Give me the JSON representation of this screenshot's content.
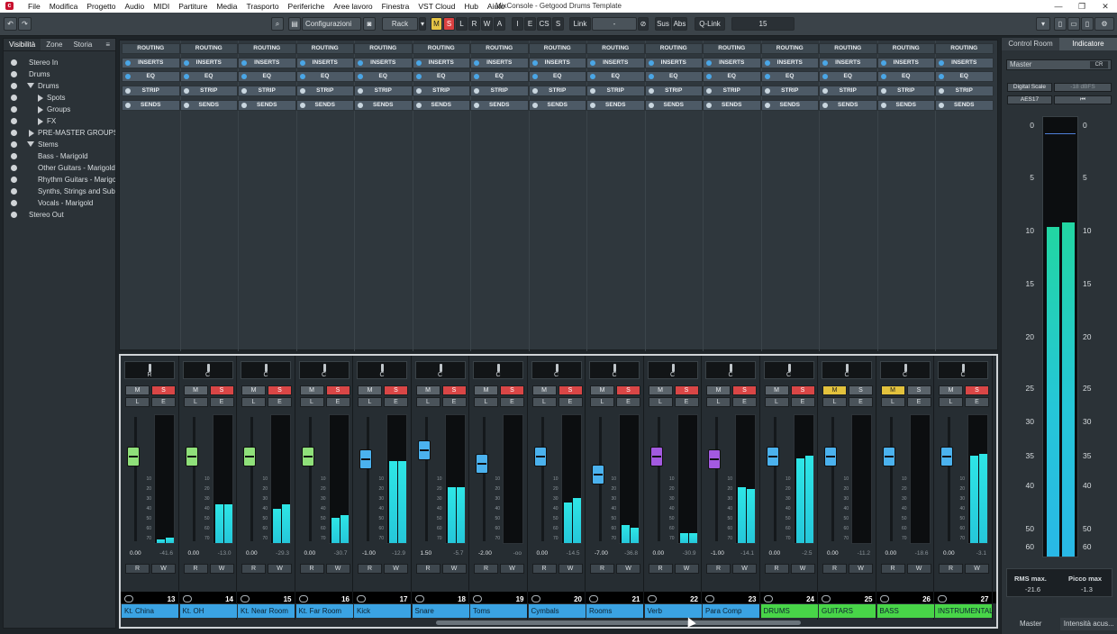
{
  "window": {
    "title": "MixConsole - Getgood Drums Template",
    "controls": [
      "—",
      "❐",
      "✕"
    ]
  },
  "menu": [
    "File",
    "Modifica",
    "Progetto",
    "Audio",
    "MIDI",
    "Partiture",
    "Media",
    "Trasporto",
    "Periferiche",
    "Aree lavoro",
    "Finestra",
    "VST Cloud",
    "Hub",
    "Aiuto"
  ],
  "toolbar": {
    "undo": "↶",
    "redo": "↷",
    "config": "Configurazioni",
    "rack": "Rack",
    "mslrwa": [
      "M",
      "S",
      "L",
      "R",
      "W",
      "A"
    ],
    "ies": [
      "I",
      "E",
      "CS",
      "S"
    ],
    "link": "Link",
    "link_value": "-",
    "sus": "Sus",
    "abs": "Abs",
    "qlink": "Q-Link",
    "count": "15"
  },
  "left_panel": {
    "tabs": [
      "Visibilità",
      "Zone",
      "Storia"
    ],
    "tree": [
      {
        "label": "Stereo In",
        "kind": "dot"
      },
      {
        "label": "Drums",
        "kind": "dot"
      },
      {
        "label": "Drums",
        "kind": "folder-open"
      },
      {
        "label": "Spots",
        "kind": "folder-closed"
      },
      {
        "label": "Groups",
        "kind": "folder-closed"
      },
      {
        "label": "FX",
        "kind": "folder-closed"
      },
      {
        "label": "PRE-MASTER GROUPS",
        "kind": "folder-closed"
      },
      {
        "label": "Stems",
        "kind": "folder-open"
      },
      {
        "label": "Bass - Marigold",
        "kind": "dot"
      },
      {
        "label": "Other Guitars - Marigold",
        "kind": "dot"
      },
      {
        "label": "Rhythm Guitars - Marigold",
        "kind": "dot"
      },
      {
        "label": "Synths, Strings and Sub...",
        "kind": "dot"
      },
      {
        "label": "Vocals - Marigold",
        "kind": "dot"
      },
      {
        "label": "Stereo Out",
        "kind": "dot"
      }
    ]
  },
  "rack_rows": [
    "ROUTING",
    "INSERTS",
    "EQ",
    "STRIP",
    "SENDS"
  ],
  "channels": [
    {
      "name": "Kt. China",
      "num": "13",
      "pan": "R",
      "vol": "0.00",
      "peak": "-41.6",
      "fader": 0.69,
      "meter": [
        0.03,
        0.04
      ],
      "cap": "green",
      "name_color": "#3aa3e3",
      "m_on": false,
      "s_on": true
    },
    {
      "name": "Kt. OH",
      "num": "14",
      "pan": "C",
      "vol": "0.00",
      "peak": "-13.0",
      "fader": 0.69,
      "meter": [
        0.3,
        0.3
      ],
      "cap": "green",
      "name_color": "#3aa3e3",
      "m_on": false,
      "s_on": true
    },
    {
      "name": "Kt. Near Room",
      "num": "15",
      "pan": "C",
      "vol": "0.00",
      "peak": "-29.3",
      "fader": 0.69,
      "meter": [
        0.27,
        0.3
      ],
      "cap": "green",
      "name_color": "#3aa3e3",
      "m_on": false,
      "s_on": true
    },
    {
      "name": "Kt. Far Room",
      "num": "16",
      "pan": "C",
      "vol": "0.00",
      "peak": "-30.7",
      "fader": 0.69,
      "meter": [
        0.2,
        0.22
      ],
      "cap": "green",
      "name_color": "#3aa3e3",
      "m_on": false,
      "s_on": true
    },
    {
      "name": "Kick",
      "num": "17",
      "pan": "C",
      "vol": "-1.00",
      "peak": "-12.9",
      "fader": 0.66,
      "meter": [
        0.64,
        0.64
      ],
      "cap": "blue",
      "name_color": "#3aa3e3",
      "m_on": false,
      "s_on": true
    },
    {
      "name": "Snare",
      "num": "18",
      "pan": "C",
      "vol": "1.50",
      "peak": "-5.7",
      "fader": 0.75,
      "meter": [
        0.44,
        0.44
      ],
      "cap": "blue",
      "name_color": "#3aa3e3",
      "m_on": false,
      "s_on": true
    },
    {
      "name": "Toms",
      "num": "19",
      "pan": "C",
      "vol": "-2.00",
      "peak": "-oo",
      "fader": 0.62,
      "meter": [
        0,
        0
      ],
      "cap": "blue",
      "name_color": "#3aa3e3",
      "m_on": false,
      "s_on": true
    },
    {
      "name": "Cymbals",
      "num": "20",
      "pan": "C",
      "vol": "0.00",
      "peak": "-14.5",
      "fader": 0.69,
      "meter": [
        0.32,
        0.35
      ],
      "cap": "blue",
      "name_color": "#3aa3e3",
      "m_on": false,
      "s_on": true
    },
    {
      "name": "Rooms",
      "num": "21",
      "pan": "C",
      "vol": "-7.00",
      "peak": "-36.8",
      "fader": 0.52,
      "meter": [
        0.14,
        0.12
      ],
      "cap": "blue",
      "name_color": "#3aa3e3",
      "m_on": false,
      "s_on": true
    },
    {
      "name": "Verb",
      "num": "22",
      "pan": "C",
      "vol": "0.00",
      "peak": "-30.9",
      "fader": 0.69,
      "meter": [
        0.08,
        0.08
      ],
      "cap": "purple",
      "name_color": "#3aa3e3",
      "m_on": false,
      "s_on": true
    },
    {
      "name": "Para Comp",
      "num": "23",
      "pan": "C",
      "vol": "-1.00",
      "peak": "-14.1",
      "fader": 0.66,
      "meter": [
        0.44,
        0.42
      ],
      "cap": "purple",
      "name_color": "#3aa3e3",
      "m_on": false,
      "s_on": true
    },
    {
      "name": "DRUMS",
      "num": "24",
      "pan": "C",
      "vol": "0.00",
      "peak": "-2.5",
      "fader": 0.69,
      "meter": [
        0.66,
        0.68
      ],
      "cap": "blue",
      "name_color": "#48d548",
      "m_on": false,
      "s_on": true
    },
    {
      "name": "GUITARS",
      "num": "25",
      "pan": "C",
      "vol": "0.00",
      "peak": "-11.2",
      "fader": 0.69,
      "meter": [
        0,
        0
      ],
      "cap": "blue",
      "name_color": "#48d548",
      "m_on": true,
      "s_on": false
    },
    {
      "name": "BASS",
      "num": "26",
      "pan": "C",
      "vol": "0.00",
      "peak": "-18.6",
      "fader": 0.69,
      "meter": [
        0,
        0
      ],
      "cap": "blue",
      "name_color": "#48d548",
      "m_on": true,
      "s_on": false
    },
    {
      "name": "INSTRUMENTAL",
      "num": "27",
      "pan": "C",
      "vol": "0.00",
      "peak": "-3.1",
      "fader": 0.69,
      "meter": [
        0.68,
        0.7
      ],
      "cap": "blue",
      "name_color": "#48d548",
      "m_on": false,
      "s_on": true
    }
  ],
  "strip_labels": {
    "m": "M",
    "s": "S",
    "l": "L",
    "e": "E",
    "r": "R",
    "w": "W"
  },
  "fader_scale": [
    "10",
    "20",
    "30",
    "40",
    "50",
    "60",
    "70"
  ],
  "right_panel": {
    "tabs": [
      "Control Room",
      "Indicatore"
    ],
    "master": "Master",
    "cr": "CR",
    "digital_scale": "Digital Scale",
    "dbfs": "-18 dBFS",
    "aes": "AES17",
    "reset": "⏮",
    "scale": [
      "0",
      "5",
      "10",
      "15",
      "20",
      "25",
      "30",
      "35",
      "40",
      "50",
      "60"
    ],
    "rms_label": "RMS max.",
    "rms_value": "-21.6",
    "peak_label": "Picco max",
    "peak_value": "-1.3",
    "meter_levels": [
      0.75,
      0.76
    ],
    "footer": [
      "Master",
      "Intensità acus..."
    ]
  }
}
